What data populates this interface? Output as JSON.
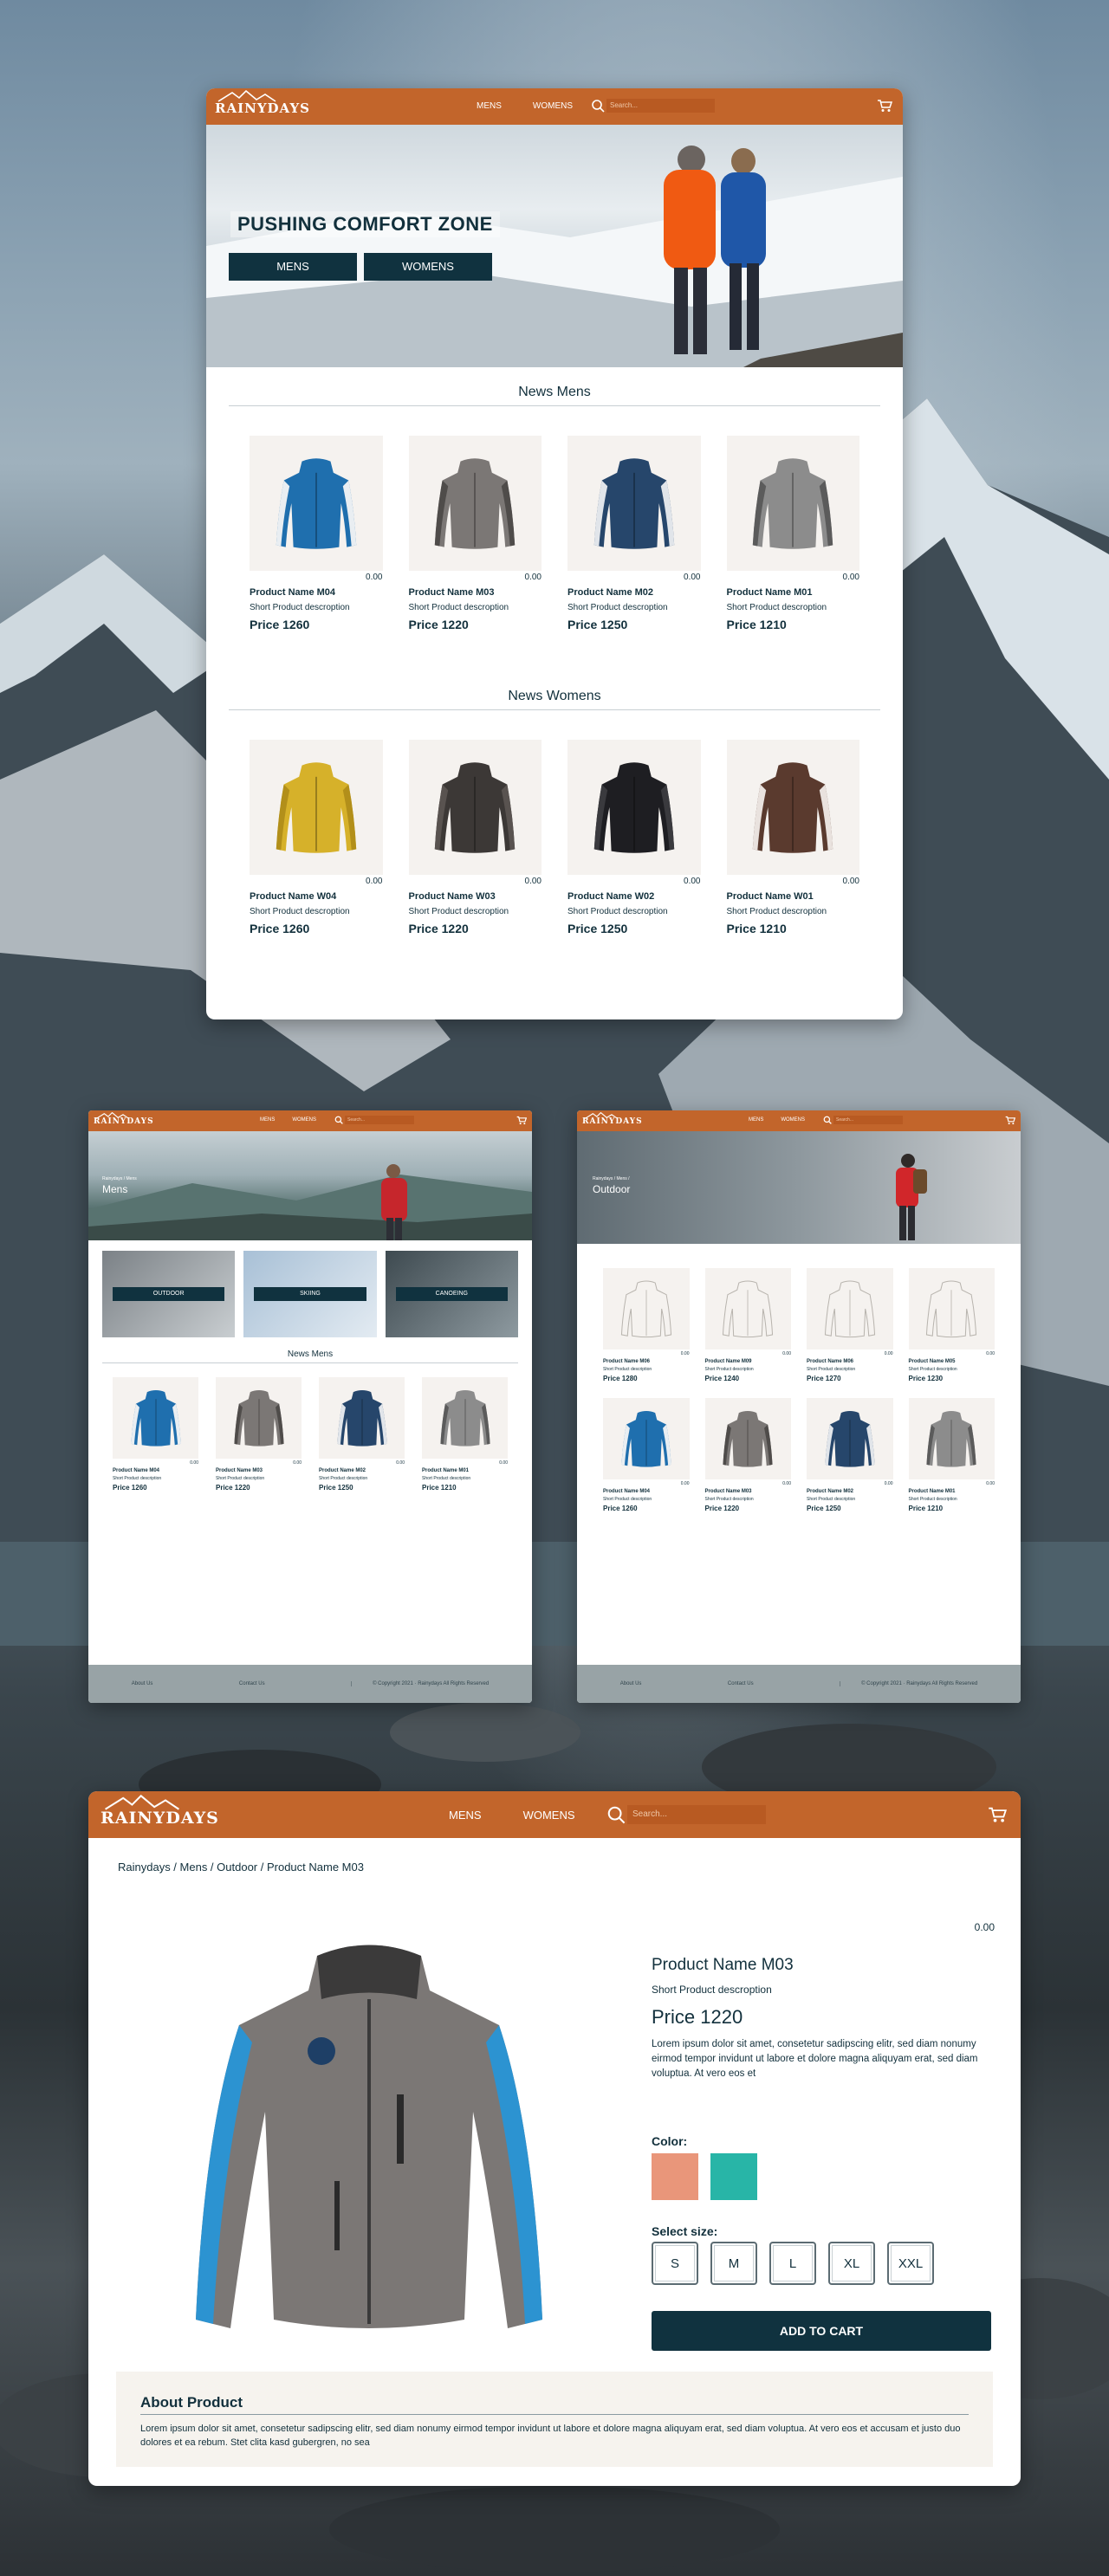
{
  "brand": "RAINYDAYS",
  "nav": {
    "mens": "MENS",
    "womens": "WOMENS",
    "search_placeholder": "Search..."
  },
  "home": {
    "hero_title": "PUSHING COMFORT ZONE",
    "btn_mens": "MENS",
    "btn_womens": "WOMENS",
    "news_mens_title": "News Mens",
    "news_womens_title": "News Womens",
    "mens_products": [
      {
        "rating": "0.00",
        "name": "Product Name M04",
        "desc": "Short Product descroption",
        "price": "Price 1260"
      },
      {
        "rating": "0.00",
        "name": "Product Name M03",
        "desc": "Short Product descroption",
        "price": "Price 1220"
      },
      {
        "rating": "0.00",
        "name": "Product Name M02",
        "desc": "Short Product descroption",
        "price": "Price 1250"
      },
      {
        "rating": "0.00",
        "name": "Product Name M01",
        "desc": "Short Product descroption",
        "price": "Price 1210"
      }
    ],
    "womens_products": [
      {
        "rating": "0.00",
        "name": "Product Name W04",
        "desc": "Short Product descroption",
        "price": "Price 1260"
      },
      {
        "rating": "0.00",
        "name": "Product Name W03",
        "desc": "Short Product descroption",
        "price": "Price 1220"
      },
      {
        "rating": "0.00",
        "name": "Product Name W02",
        "desc": "Short Product descroption",
        "price": "Price 1250"
      },
      {
        "rating": "0.00",
        "name": "Product Name W01",
        "desc": "Short Product descroption",
        "price": "Price 1210"
      }
    ]
  },
  "mens_page": {
    "breadcrumb": "Rainydays / Mens",
    "hero_title": "Mens",
    "categories": [
      "OUTDOOR",
      "SKIING",
      "CANOEING"
    ],
    "news_title": "News Mens",
    "products": [
      {
        "rating": "0.00",
        "name": "Product Name M04",
        "desc": "Short Product description",
        "price": "Price 1260"
      },
      {
        "rating": "0.00",
        "name": "Product Name M03",
        "desc": "Short Product description",
        "price": "Price 1220"
      },
      {
        "rating": "0.00",
        "name": "Product Name M02",
        "desc": "Short Product description",
        "price": "Price 1250"
      },
      {
        "rating": "0.00",
        "name": "Product Name M01",
        "desc": "Short Product description",
        "price": "Price 1210"
      }
    ],
    "footer": {
      "about": "About Us",
      "contact": "Contact Us",
      "copyright": "© Copyright 2021 · Rainydays All Rights Reserved"
    }
  },
  "outdoor_page": {
    "breadcrumb": "Rainydays / Mens /",
    "hero_title": "Outdoor",
    "row1": [
      {
        "rating": "0.00",
        "name": "Product Name M06",
        "desc": "Short Product description",
        "price": "Price 1280"
      },
      {
        "rating": "0.00",
        "name": "Product Name M09",
        "desc": "Short Product description",
        "price": "Price 1240"
      },
      {
        "rating": "0.00",
        "name": "Product Name M06",
        "desc": "Short Product description",
        "price": "Price 1270"
      },
      {
        "rating": "0.00",
        "name": "Product Name M05",
        "desc": "Short Product description",
        "price": "Price 1230"
      }
    ],
    "row2": [
      {
        "rating": "0.00",
        "name": "Product Name M04",
        "desc": "Short Product description",
        "price": "Price 1260"
      },
      {
        "rating": "0.00",
        "name": "Product Name M03",
        "desc": "Short Product description",
        "price": "Price 1220"
      },
      {
        "rating": "0.00",
        "name": "Product Name M02",
        "desc": "Short Product description",
        "price": "Price 1250"
      },
      {
        "rating": "0.00",
        "name": "Product Name M01",
        "desc": "Short Product description",
        "price": "Price 1210"
      }
    ],
    "footer": {
      "about": "About Us",
      "contact": "Contact Us",
      "copyright": "© Copyright 2021 · Rainydays All Rights Reserved"
    }
  },
  "product_page": {
    "breadcrumb": "Rainydays / Mens / Outdoor / Product Name M03",
    "rating": "0.00",
    "name": "Product Name M03",
    "desc": "Short Product descroption",
    "price": "Price 1220",
    "body": "Lorem ipsum dolor sit amet, consetetur sadipscing elitr, sed diam nonumy eirmod tempor invidunt ut labore et dolore magna aliquyam erat, sed diam voluptua. At vero eos et",
    "color_label": "Color:",
    "colors": [
      "#e9967a",
      "#28b5a7"
    ],
    "size_label": "Select size:",
    "sizes": [
      "S",
      "M",
      "L",
      "XL",
      "XXL"
    ],
    "add_to_cart": "ADD TO CART",
    "about_title": "About Product",
    "about_text": "Lorem ipsum dolor sit amet, consetetur sadipscing elitr, sed diam nonumy eirmod tempor invidunt ut labore et dolore magna aliquyam erat, sed diam voluptua. At vero eos et accusam et justo duo dolores et ea rebum. Stet clita kasd gubergren, no sea"
  },
  "colors": {
    "brand_orange": "#c2652b",
    "navy": "#10323f",
    "footer_grey": "#98a3a6",
    "thumb_bg": "#f5f2ef"
  }
}
